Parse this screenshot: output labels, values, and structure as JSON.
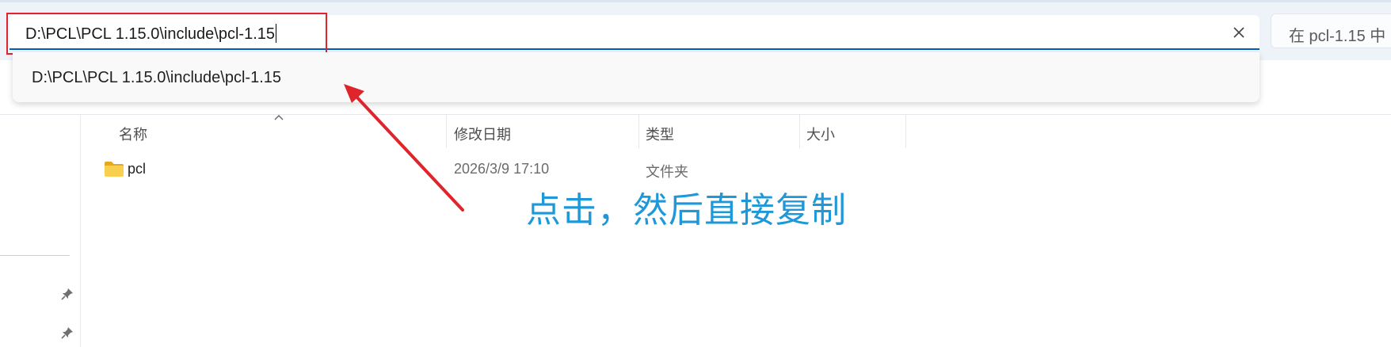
{
  "address_bar": {
    "value": "D:\\PCL\\PCL 1.15.0\\include\\pcl-1.15",
    "clear_icon": "close-icon"
  },
  "search": {
    "placeholder": "在 pcl-1.15 中"
  },
  "dropdown": {
    "suggestion": "D:\\PCL\\PCL 1.15.0\\include\\pcl-1.15"
  },
  "columns": {
    "name": "名称",
    "modified": "修改日期",
    "type": "类型",
    "size": "大小"
  },
  "files": [
    {
      "name": "pcl",
      "modified": "2026/3/9 17:10",
      "type": "文件夹",
      "size": "",
      "icon": "folder-icon"
    }
  ],
  "annotation": {
    "text": "点击，然后直接复制",
    "color": "#1e98d8",
    "arrow_color": "#e0242b"
  },
  "colors": {
    "accent": "#005fb8",
    "highlight": "#e0242b"
  }
}
